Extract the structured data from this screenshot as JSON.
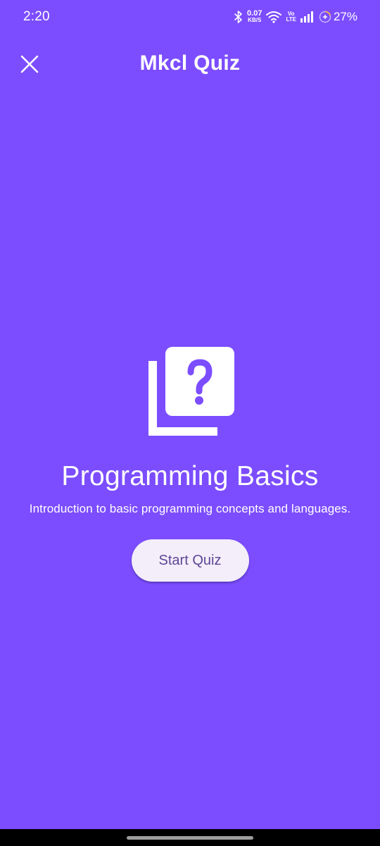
{
  "status_bar": {
    "time": "2:20",
    "net_speed_value": "0.07",
    "net_speed_unit": "KB/S",
    "volte_top": "Vo",
    "volte_bottom": "LTE",
    "battery": "27%"
  },
  "app_bar": {
    "title": "Mkcl Quiz",
    "close_icon": "close-icon"
  },
  "quiz": {
    "icon": "quiz-question-icon",
    "title": "Programming Basics",
    "description": "Introduction to basic programming concepts and languages.",
    "start_label": "Start Quiz"
  },
  "colors": {
    "background": "#7c4dff",
    "button_bg": "#f3eef9",
    "button_text": "#5e4696"
  }
}
